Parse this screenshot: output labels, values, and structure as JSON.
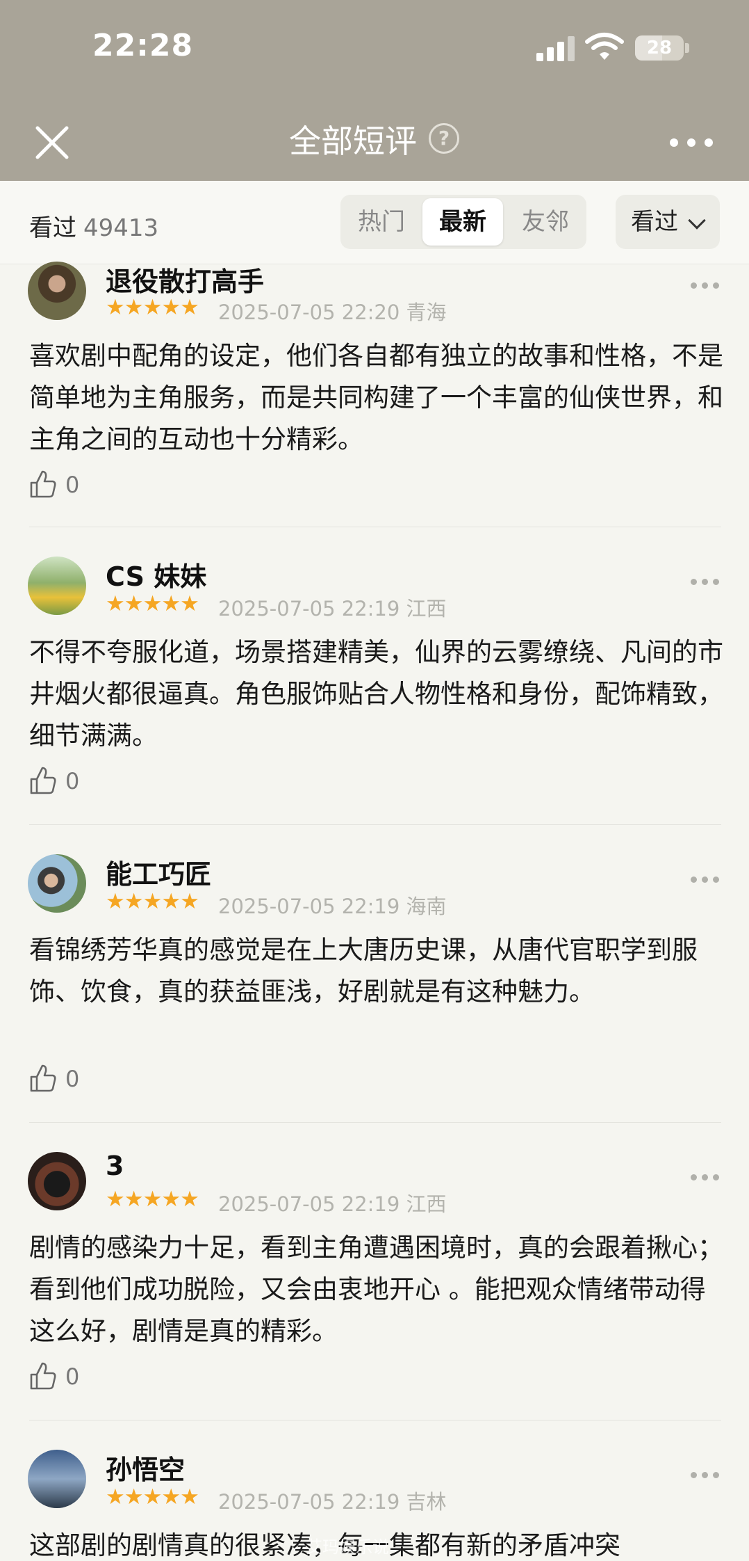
{
  "status_bar": {
    "time": "22:28",
    "battery": "28"
  },
  "nav": {
    "title": "全部短评",
    "help_icon": "?"
  },
  "filter": {
    "seen_label": "看过",
    "seen_count": "49413",
    "tabs": [
      "热门",
      "最新",
      "友邻"
    ],
    "active_tab": "最新",
    "dropdown_label": "看过"
  },
  "reviews": [
    {
      "username": "退役散打高手",
      "stars": "★★★★★",
      "date": "2025-07-05 22:20",
      "location": "青海",
      "text": "喜欢剧中配角的设定，他们各自都有独立的故事和性格，不是简单地为主角服务，而是共同构建了一个丰富的仙侠世界，和主角之间的互动也十分精彩。",
      "likes": "0"
    },
    {
      "username": "CS 妹妹",
      "stars": "★★★★★",
      "date": "2025-07-05 22:19",
      "location": "江西",
      "text": "不得不夸服化道，场景搭建精美，仙界的云雾缭绕、凡间的市井烟火都很逼真。角色服饰贴合人物性格和身份，配饰精致，细节满满。",
      "likes": "0"
    },
    {
      "username": "能工巧匠",
      "stars": "★★★★★",
      "date": "2025-07-05 22:19",
      "location": "海南",
      "text": "看锦绣芳华真的感觉是在上大唐历史课，从唐代官职学到服饰、饮食，真的获益匪浅，好剧就是有这种魅力。",
      "likes": "0"
    },
    {
      "username": "3",
      "stars": "★★★★★",
      "date": "2025-07-05 22:19",
      "location": "江西",
      "text": "剧情的感染力十足，看到主角遭遇困境时，真的会跟着揪心；看到他们成功脱险，又会由衷地开心 。能把观众情绪带动得这么好，剧情是真的精彩。",
      "likes": "0"
    },
    {
      "username": "孙悟空",
      "stars": "★★★★★",
      "date": "2025-07-05 22:19",
      "location": "吉林",
      "text": "这部剧的剧情真的很紧凑，每一集都有新的矛盾冲突",
      "likes": ""
    }
  ],
  "watermark": "艾玛娱乐说",
  "colors": {
    "header_bg": "#a9a498",
    "page_bg": "#f5f5f0",
    "star": "#f5a623",
    "meta": "#b3b3ad"
  },
  "icons": [
    "close-icon",
    "help-icon",
    "more-icon",
    "thumbs-up-icon",
    "chevron-down-icon",
    "signal-icon",
    "wifi-icon",
    "battery-icon"
  ]
}
